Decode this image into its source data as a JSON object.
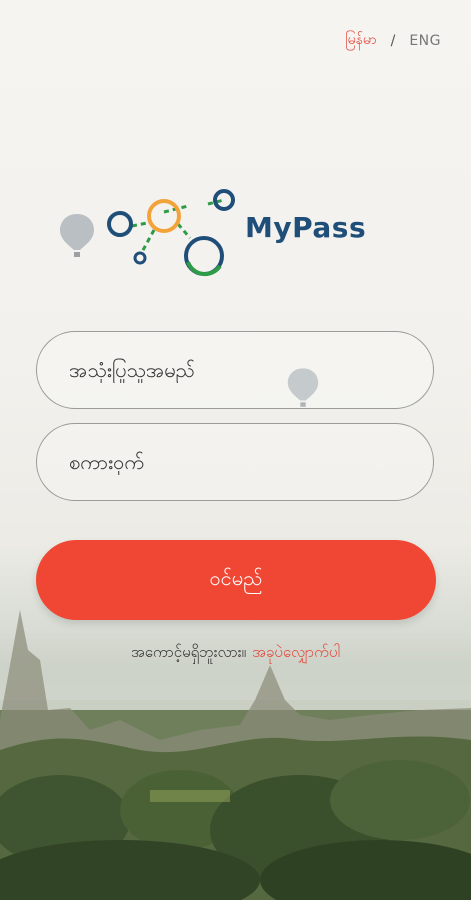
{
  "language": {
    "myanmar_label": "မြန်မာ",
    "separator": "/",
    "english_label": "ENG"
  },
  "brand": {
    "name": "MyPass"
  },
  "form": {
    "username_placeholder": "အသုံးပြုသူအမည်",
    "password_placeholder": "စကားဝှက်",
    "login_label": "ဝင်မည်"
  },
  "forgot": {
    "question": "အကောင့်မရှိဘူးလား။",
    "link": "အခုပဲလျှောက်ပါ"
  },
  "colors": {
    "accent": "#ef4733",
    "brand_blue": "#1f4e79"
  }
}
